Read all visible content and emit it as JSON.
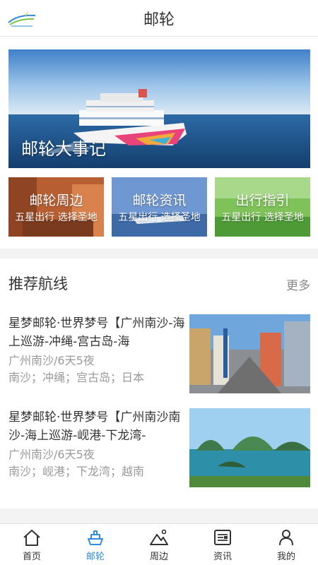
{
  "header": {
    "title": "邮轮",
    "logo_icon": "brand-logo"
  },
  "hero": {
    "label": "邮轮大事记"
  },
  "tiles": [
    {
      "title": "邮轮周边",
      "subtitle": "五星出行 选择圣地",
      "color": "#c5683a"
    },
    {
      "title": "邮轮资讯",
      "subtitle": "五星出行 选择圣地",
      "color": "#5b86c4"
    },
    {
      "title": "出行指引",
      "subtitle": "五星出行 选择圣地",
      "color": "#6fb04a"
    }
  ],
  "section": {
    "title": "推荐航线",
    "more": "更多"
  },
  "routes": [
    {
      "name": "星梦邮轮·世界梦号【广州南沙-海上巡游-冲绳-宫古岛-海",
      "meta": "广州南沙/6天5夜",
      "ports": "南沙；冲绳；宫古岛；日本"
    },
    {
      "name": "星梦邮轮·世界梦号【广州南沙南沙-海上巡游-岘港-下龙湾-",
      "meta": "广州南沙/6天5夜",
      "ports": "南沙；岘港；下龙湾；越南"
    }
  ],
  "tabbar": {
    "accent": "#2f8de4",
    "items": [
      {
        "label": "首页",
        "icon": "home-icon",
        "active": false
      },
      {
        "label": "邮轮",
        "icon": "cruise-ship-icon",
        "active": true
      },
      {
        "label": "周边",
        "icon": "mountain-icon",
        "active": false
      },
      {
        "label": "资讯",
        "icon": "news-icon",
        "active": false
      },
      {
        "label": "我的",
        "icon": "user-icon",
        "active": false
      }
    ]
  }
}
